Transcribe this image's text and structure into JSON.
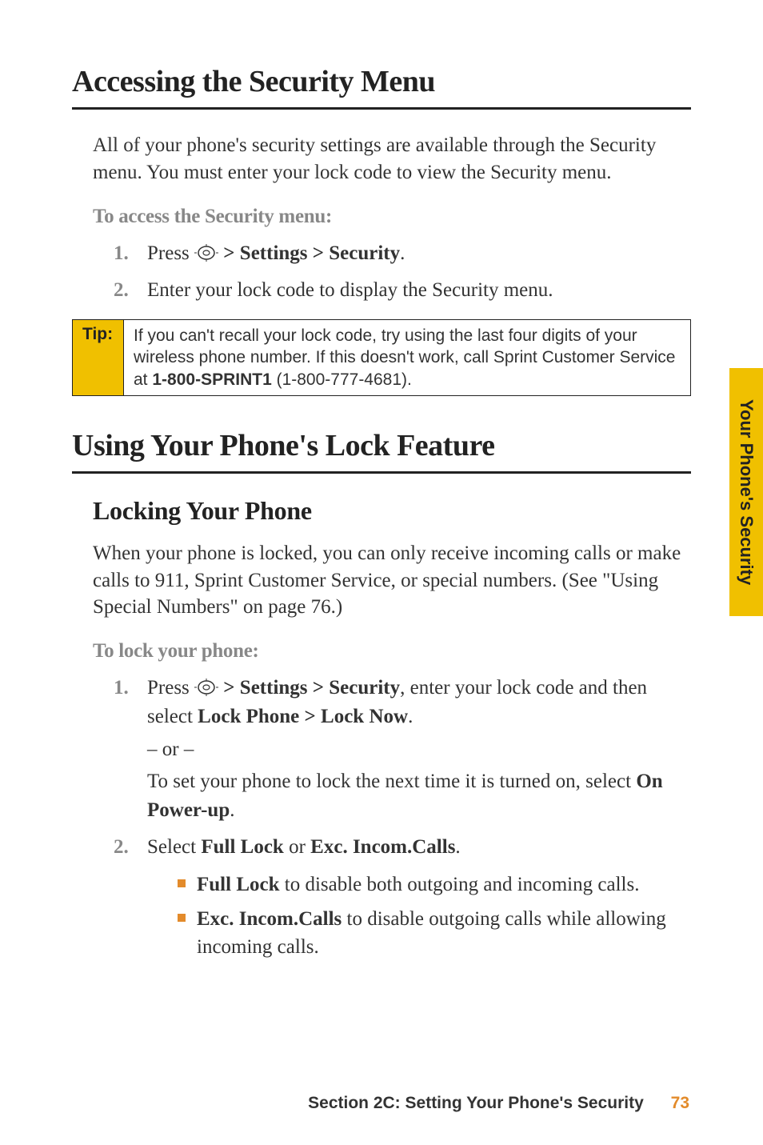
{
  "heading1": "Accessing the Security Menu",
  "intro1": "All of your phone's security settings are available through the Security menu. You must enter your lock code to view the Security menu.",
  "subhead1": "To access the Security menu:",
  "step1_1_a": "Press ",
  "step1_1_b": " > Settings > Security",
  "step1_1_c": ".",
  "step1_2": "Enter your lock code to display the Security menu.",
  "tip_label": "Tip:",
  "tip_text_a": "If you can't recall your lock code, try using the last four digits of your wireless phone number. If this doesn't work, call Sprint Customer Service at ",
  "tip_text_b": "1-800-SPRINT1",
  "tip_text_c": " (1-800-777-4681).",
  "heading2": "Using Your Phone's Lock Feature",
  "heading3": "Locking Your Phone",
  "intro2": "When your phone is locked, you can only receive incoming calls or make calls to 911, Sprint Customer Service, or special numbers. (See \"Using Special Numbers\" on page 76.)",
  "subhead2": "To lock your phone:",
  "step2_1_a": "Press ",
  "step2_1_b": " > Settings > Security",
  "step2_1_c": ", enter your lock code and then select ",
  "step2_1_d": "Lock Phone > Lock Now",
  "step2_1_e": ".",
  "or": "– or –",
  "step2_1_f": "To set your phone to lock the next time it is turned on, select ",
  "step2_1_g": "On Power-up",
  "step2_1_h": ".",
  "step2_2_a": "Select ",
  "step2_2_b": "Full Lock",
  "step2_2_c": " or ",
  "step2_2_d": "Exc. Incom.Calls",
  "step2_2_e": ".",
  "bullet1_a": "Full Lock",
  "bullet1_b": " to disable both outgoing and incoming calls.",
  "bullet2_a": "Exc. Incom.Calls",
  "bullet2_b": " to disable outgoing calls while allowing incoming calls.",
  "sidetab": "Your Phone's Security",
  "footer": "Section 2C: Setting Your Phone's Security",
  "page": "73",
  "num1": "1.",
  "num2": "2."
}
